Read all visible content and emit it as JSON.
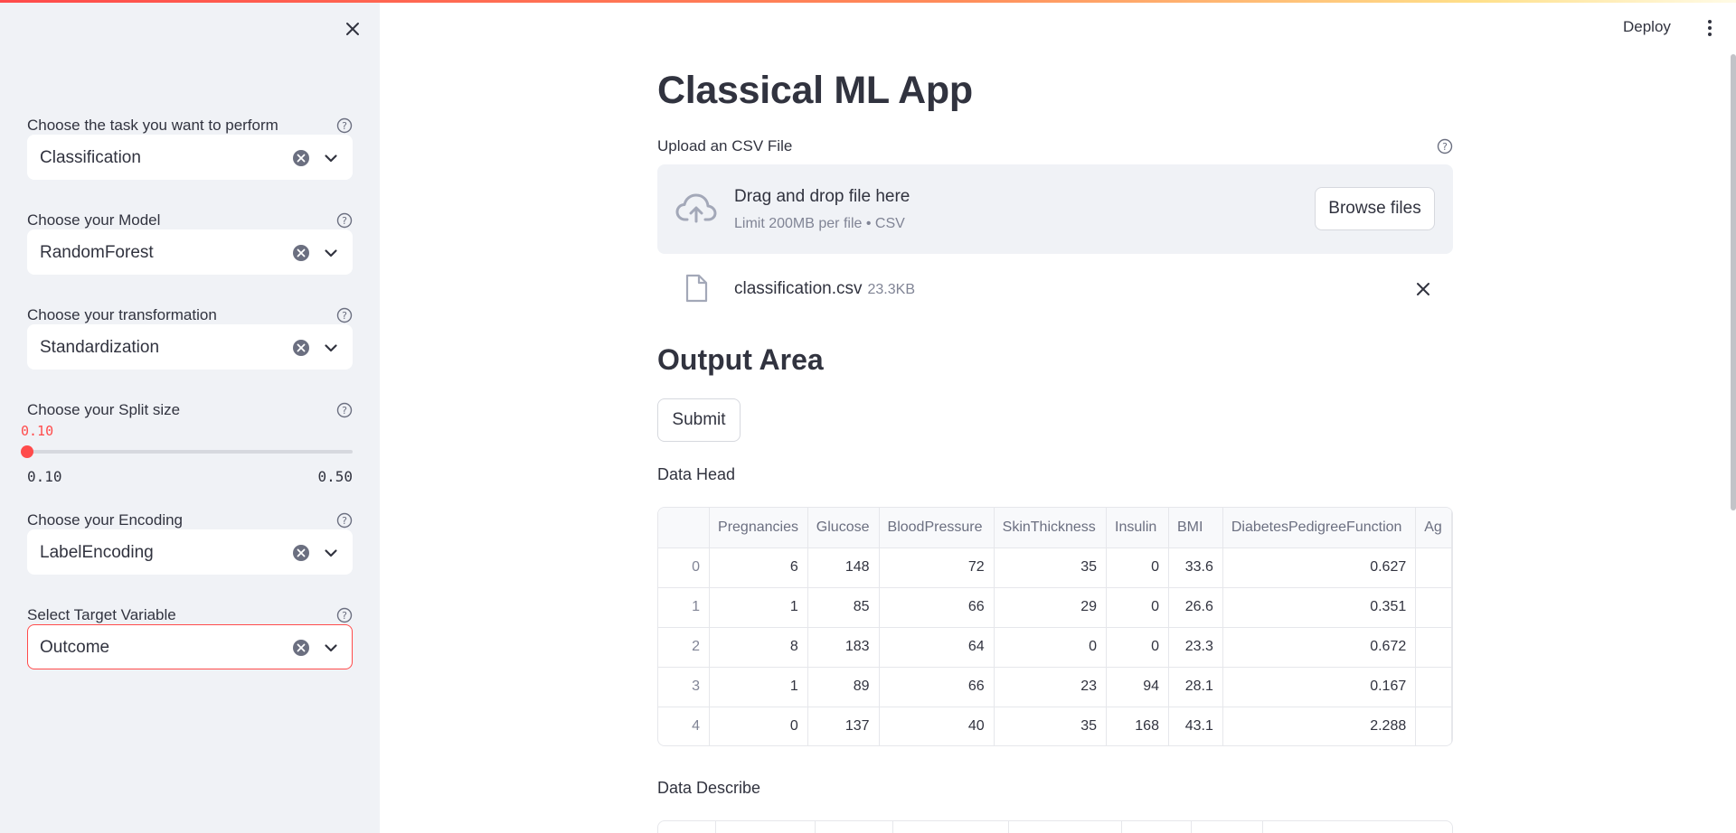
{
  "sidebar": {
    "fields": [
      {
        "label": "Choose the task you want to perform",
        "value": "Classification"
      },
      {
        "label": "Choose your Model",
        "value": "RandomForest"
      },
      {
        "label": "Choose your transformation",
        "value": "Standardization"
      },
      {
        "label": "Choose your Encoding",
        "value": "LabelEncoding"
      },
      {
        "label": "Select Target Variable",
        "value": "Outcome"
      }
    ],
    "slider": {
      "label": "Choose your Split size",
      "value": "0.10",
      "min": "0.10",
      "max": "0.50",
      "fraction": 0.0
    }
  },
  "header": {
    "deploy_label": "Deploy"
  },
  "main": {
    "title": "Classical ML App",
    "upload": {
      "label": "Upload an CSV File",
      "drop_title": "Drag and drop file here",
      "drop_sub": "Limit 200MB per file • CSV",
      "browse_label": "Browse files",
      "file_name": "classification.csv",
      "file_size": "23.3KB"
    },
    "output_title": "Output Area",
    "submit_label": "Submit",
    "data_head_label": "Data Head",
    "data_describe_label": "Data Describe",
    "table": {
      "columns": [
        "",
        "Pregnancies",
        "Glucose",
        "BloodPressure",
        "SkinThickness",
        "Insulin",
        "BMI",
        "DiabetesPedigreeFunction",
        "Ag"
      ],
      "rows": [
        [
          "0",
          "6",
          "148",
          "72",
          "35",
          "0",
          "33.6",
          "0.627",
          ""
        ],
        [
          "1",
          "1",
          "85",
          "66",
          "29",
          "0",
          "26.6",
          "0.351",
          ""
        ],
        [
          "2",
          "8",
          "183",
          "64",
          "0",
          "0",
          "23.3",
          "0.672",
          ""
        ],
        [
          "3",
          "1",
          "89",
          "66",
          "23",
          "94",
          "28.1",
          "0.167",
          ""
        ],
        [
          "4",
          "0",
          "137",
          "40",
          "35",
          "168",
          "43.1",
          "2.288",
          ""
        ]
      ]
    }
  }
}
